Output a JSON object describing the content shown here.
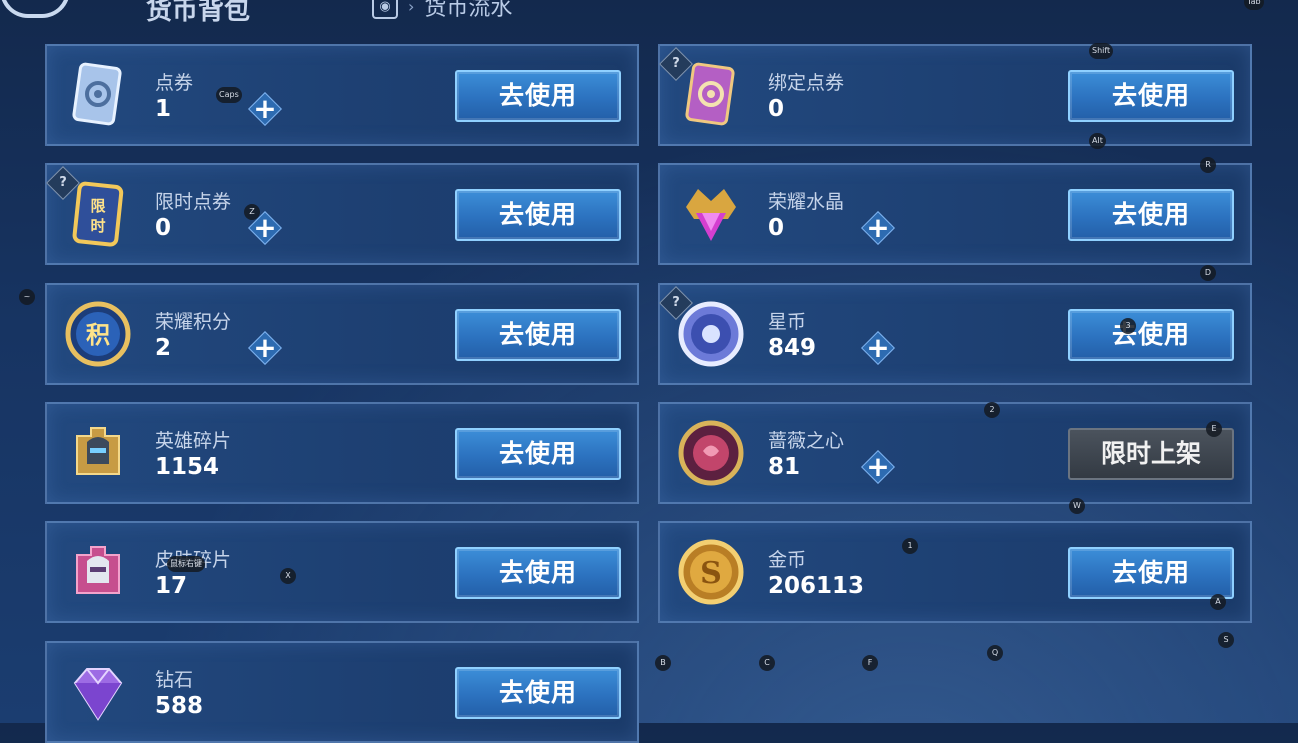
{
  "header": {
    "title": "货币背包",
    "flow_tab": "货币流水",
    "flow_icon": "ticket-icon"
  },
  "use_label": "去使用",
  "limited_label": "限时上架",
  "cards": [
    {
      "name": "点券",
      "count": "1",
      "icon": "ticket-icon",
      "plus": true,
      "help": false,
      "action": "use"
    },
    {
      "name": "绑定点券",
      "count": "0",
      "icon": "bound-ticket-icon",
      "plus": false,
      "help": true,
      "action": "use"
    },
    {
      "name": "限时点券",
      "count": "0",
      "icon": "limited-ticket-icon",
      "plus": true,
      "help": true,
      "action": "use"
    },
    {
      "name": "荣耀水晶",
      "count": "0",
      "icon": "crystal-icon",
      "plus": true,
      "help": false,
      "action": "use"
    },
    {
      "name": "荣耀积分",
      "count": "2",
      "icon": "points-icon",
      "plus": true,
      "help": false,
      "action": "use"
    },
    {
      "name": "星币",
      "count": "849",
      "icon": "star-coin-icon",
      "plus": true,
      "help": true,
      "action": "use"
    },
    {
      "name": "英雄碎片",
      "count": "1154",
      "icon": "hero-fragment-icon",
      "plus": false,
      "help": false,
      "action": "use"
    },
    {
      "name": "蔷薇之心",
      "count": "81",
      "icon": "rose-heart-icon",
      "plus": true,
      "help": false,
      "action": "limited"
    },
    {
      "name": "皮肤碎片",
      "count": "17",
      "icon": "skin-fragment-icon",
      "plus": false,
      "help": false,
      "action": "use"
    },
    {
      "name": "金币",
      "count": "206113",
      "icon": "gold-coin-icon",
      "plus": false,
      "help": false,
      "action": "use"
    },
    {
      "name": "钻石",
      "count": "588",
      "icon": "diamond-icon",
      "plus": false,
      "help": false,
      "action": "use"
    }
  ],
  "help_glyph": "?",
  "key_hints": [
    "Tab",
    "Shift",
    "Caps",
    "Alt",
    "R",
    "Z",
    "D",
    "~",
    "3",
    "2",
    "E",
    "W",
    "1",
    "X",
    "A",
    "S",
    "B",
    "C",
    "F",
    "Q",
    "鼠标右键"
  ]
}
